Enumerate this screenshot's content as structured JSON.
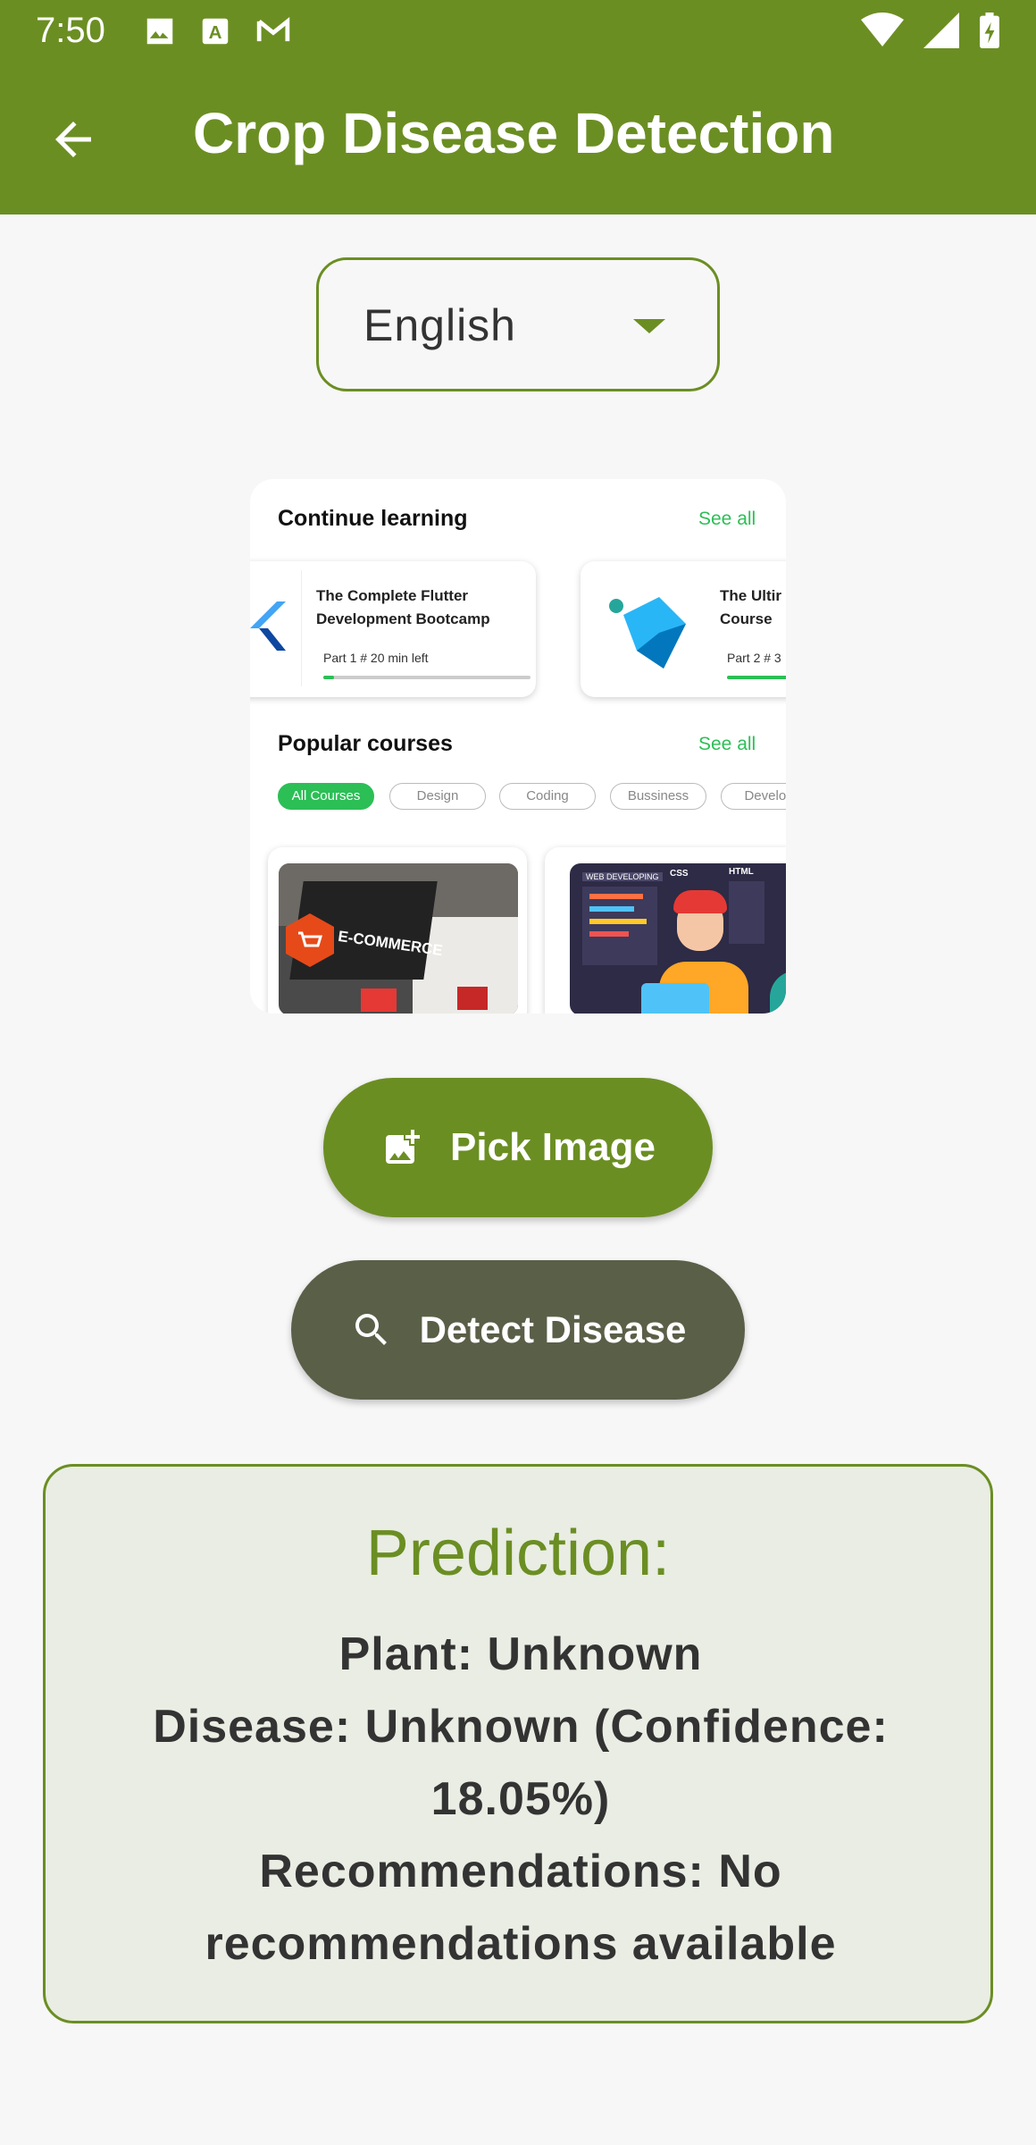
{
  "status_bar": {
    "time": "7:50"
  },
  "app_bar": {
    "title": "Crop Disease Detection"
  },
  "language_dropdown": {
    "value": "English"
  },
  "preview": {
    "continue_heading": "Continue learning",
    "see_all_1": "See all",
    "course1_title": "The Complete Flutter Development Bootcamp",
    "course1_progress_text": "Part 1 # 20 min left",
    "course1_progress": 0.05,
    "course2_title": "The Ultir Course",
    "course2_progress_text": "Part 2 # 3",
    "popular_heading": "Popular courses",
    "see_all_2": "See all",
    "chips": [
      "All Courses",
      "Design",
      "Coding",
      "Bussiness",
      "Develop"
    ],
    "thumb1_text": "E-COMMERCE",
    "thumb2_tags": [
      "WEB DEVELOPING",
      "CSS",
      "HTML"
    ]
  },
  "buttons": {
    "pick_image": "Pick Image",
    "detect_disease": "Detect Disease"
  },
  "prediction": {
    "heading": "Prediction:",
    "plant": "Plant: Unknown",
    "disease": "Disease: Unknown (Confidence: 18.05%)",
    "recommendations": "Recommendations: No recommendations available"
  },
  "colors": {
    "primary": "#6b8e23",
    "detect_button": "#5a5f48",
    "card_bg": "#e9ede3",
    "accent_green": "#2cbf56"
  }
}
